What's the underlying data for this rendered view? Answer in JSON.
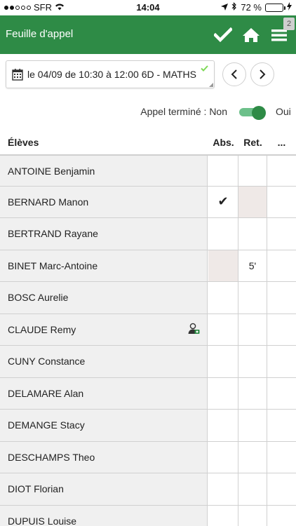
{
  "status_bar": {
    "carrier": "SFR",
    "time": "14:04",
    "battery": "72 %",
    "battery_level": 0.72
  },
  "header": {
    "title": "Feuille d'appel",
    "badge": "2"
  },
  "session": {
    "label": "le 04/09 de 10:30 à 12:00 6D - MATHS"
  },
  "toggle": {
    "label": "Appel terminé : Non",
    "on_label": "Oui",
    "checked": true
  },
  "table": {
    "headers": {
      "students": "Élèves",
      "absent": "Abs.",
      "late": "Ret.",
      "more": "..."
    },
    "rows": [
      {
        "name": "ANTOINE Benjamin",
        "abs": "",
        "ret": ""
      },
      {
        "name": "BERNARD Manon",
        "abs": "✔",
        "ret": ""
      },
      {
        "name": "BERTRAND Rayane",
        "abs": "",
        "ret": ""
      },
      {
        "name": "BINET Marc-Antoine",
        "abs": "",
        "ret": "5'"
      },
      {
        "name": "BOSC Aurelie",
        "abs": "",
        "ret": ""
      },
      {
        "name": "CLAUDE Remy",
        "abs": "",
        "ret": ""
      },
      {
        "name": "CUNY Constance",
        "abs": "",
        "ret": ""
      },
      {
        "name": "DELAMARE Alan",
        "abs": "",
        "ret": ""
      },
      {
        "name": "DEMANGE Stacy",
        "abs": "",
        "ret": ""
      },
      {
        "name": "DESCHAMPS Theo",
        "abs": "",
        "ret": ""
      },
      {
        "name": "DIOT Florian",
        "abs": "",
        "ret": ""
      },
      {
        "name": "DUPUIS Louise",
        "abs": "",
        "ret": ""
      }
    ]
  },
  "colors": {
    "header_bg": "#2e8b46",
    "toggle_on": "#2e8b46",
    "disabled_cell": "#efe9e7"
  }
}
